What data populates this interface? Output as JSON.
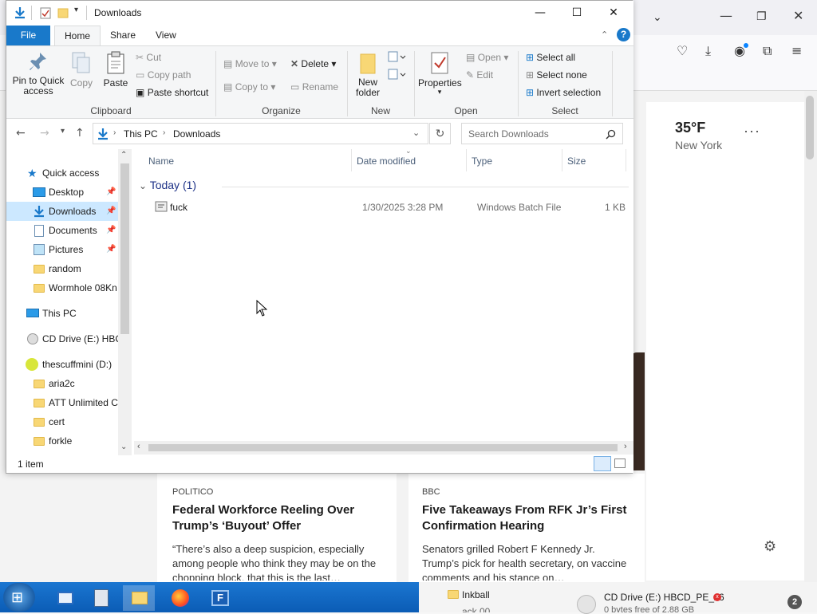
{
  "explorer": {
    "title": "Downloads",
    "tabs": [
      "File",
      "Home",
      "Share",
      "View"
    ],
    "ribbon": {
      "clipboard": {
        "pin": "Pin to Quick\naccess",
        "copy": "Copy",
        "paste": "Paste",
        "cut": "Cut",
        "copy_path": "Copy path",
        "paste_shortcut": "Paste shortcut",
        "label": "Clipboard"
      },
      "organize": {
        "move_to": "Move to",
        "copy_to": "Copy to",
        "delete": "Delete",
        "rename": "Rename",
        "label": "Organize"
      },
      "new": {
        "new_folder": "New\nfolder",
        "label": "New"
      },
      "open": {
        "properties": "Properties",
        "open": "Open",
        "edit": "Edit",
        "label": "Open"
      },
      "select": {
        "select_all": "Select all",
        "select_none": "Select none",
        "invert": "Invert selection",
        "label": "Select"
      }
    },
    "address": {
      "segments": [
        "This PC",
        "Downloads"
      ]
    },
    "search": {
      "placeholder": "Search Downloads"
    },
    "nav": [
      {
        "label": "Quick access"
      },
      {
        "label": "Desktop"
      },
      {
        "label": "Downloads"
      },
      {
        "label": "Documents"
      },
      {
        "label": "Pictures"
      },
      {
        "label": "random"
      },
      {
        "label": "Wormhole 08Kn"
      },
      {
        "label": "This PC"
      },
      {
        "label": "CD Drive (E:) HBC"
      },
      {
        "label": "thescuffmini (D:)"
      },
      {
        "label": "aria2c"
      },
      {
        "label": "ATT Unlimited C"
      },
      {
        "label": "cert"
      },
      {
        "label": "forkle"
      }
    ],
    "columns": {
      "name": "Name",
      "date": "Date modified",
      "type": "Type",
      "size": "Size"
    },
    "group": "Today (1)",
    "files": [
      {
        "name": "fuck",
        "date": "1/30/2025 3:28 PM",
        "type": "Windows Batch File",
        "size": "1 KB"
      }
    ],
    "status": "1 item"
  },
  "browser": {
    "weather": {
      "temp": "35°F",
      "location": "New York",
      "more": "···"
    },
    "cards": [
      {
        "source": "POLITICO",
        "headline": "Federal Workforce Reeling Over Trump’s ‘Buyout’ Offer",
        "snippet": "“There’s also a deep suspicion, especially among people who think they may be on the chopping block, that this is the last…"
      },
      {
        "source": "BBC",
        "headline": "Five Takeaways From RFK Jr’s First Confirmation Hearing",
        "snippet": "Senators grilled Robert F Kennedy Jr. Trump’s pick for health secretary, on vaccine comments and his stance on…"
      }
    ]
  },
  "taskbar": {
    "folder_item": "Inkball",
    "folder_item2": "ack 00",
    "drive_notice": "CD Drive (E:) HBCD_PE_x6",
    "drive_sub": "0 bytes free of 2.88 GB",
    "badge": "2"
  },
  "colors": {
    "accent": "#1979ca",
    "selected": "#cce8ff",
    "taskbar": "#0b5cb5"
  }
}
